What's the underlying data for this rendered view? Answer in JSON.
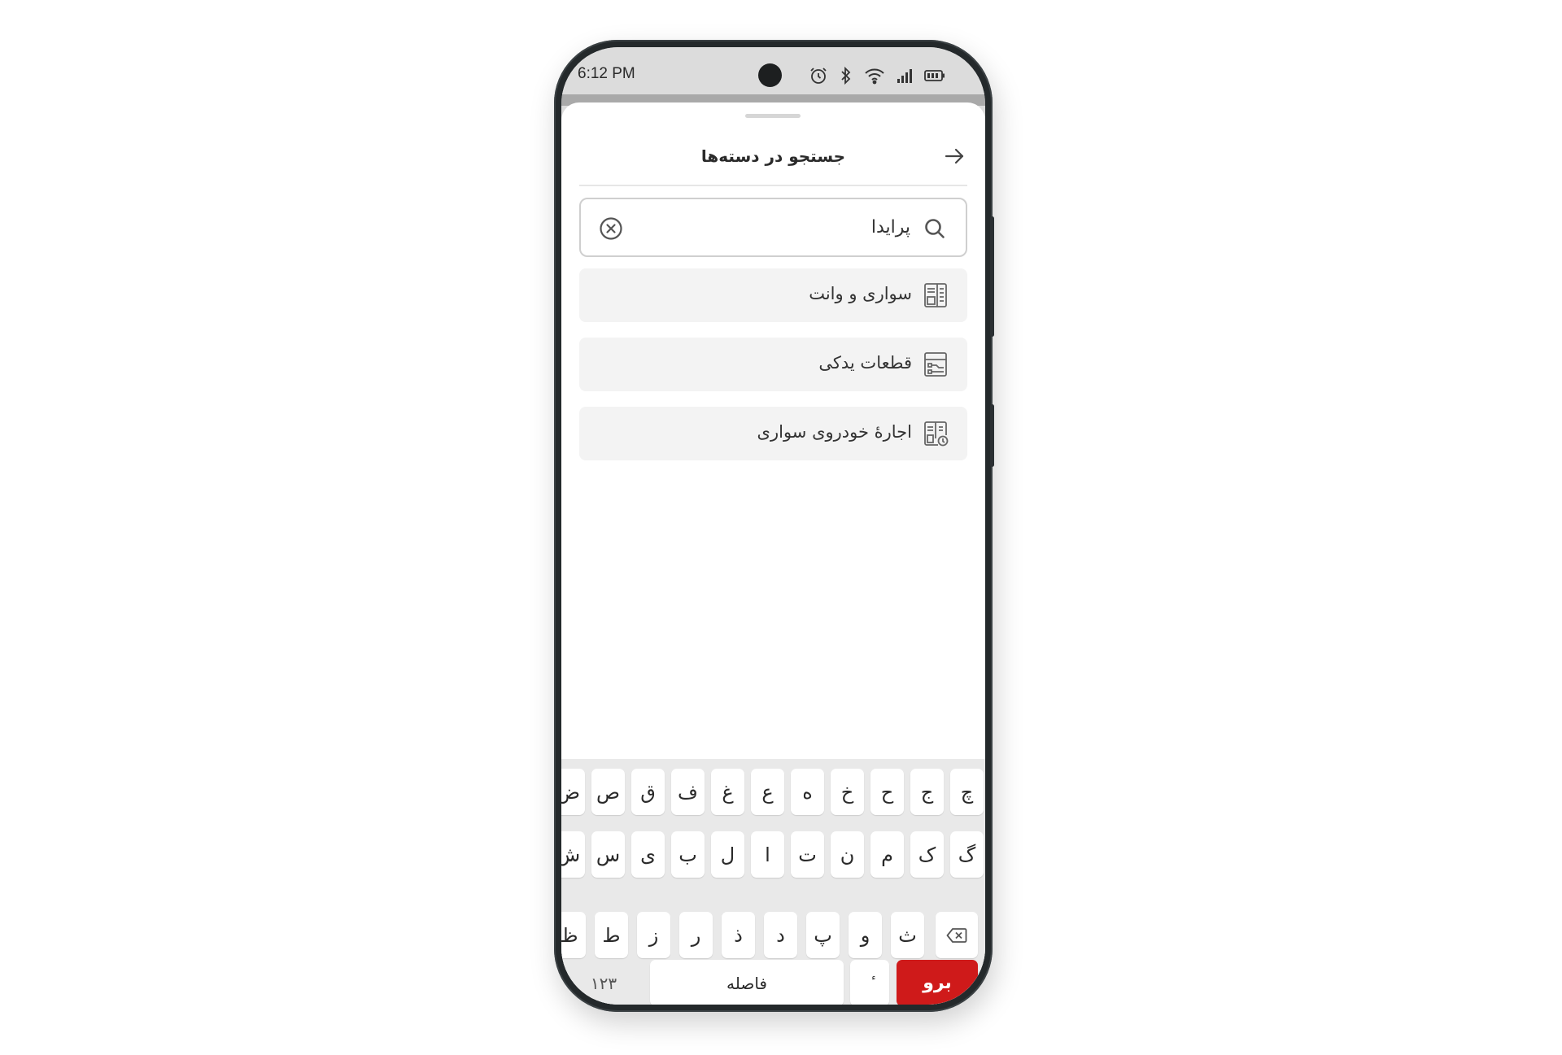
{
  "status_bar": {
    "time": "6:12 PM"
  },
  "header": {
    "title": "جستجو در دسته‌ها"
  },
  "search": {
    "value": "پرایدا"
  },
  "results": [
    {
      "label": "سواری و وانت",
      "icon": "car-category-icon"
    },
    {
      "label": "قطعات یدکی",
      "icon": "spare-parts-category-icon"
    },
    {
      "label": "اجارهٔ خودروی سواری",
      "icon": "car-rental-category-icon"
    }
  ],
  "keyboard": {
    "row1": [
      "چ",
      "ج",
      "ح",
      "خ",
      "ه",
      "ع",
      "غ",
      "ف",
      "ق",
      "ص",
      "ض"
    ],
    "row2": [
      "گ",
      "ک",
      "م",
      "ن",
      "ت",
      "ا",
      "ل",
      "ب",
      "ی",
      "س",
      "ش"
    ],
    "row3": [
      "ث",
      "و",
      "پ",
      "د",
      "ذ",
      "ر",
      "ز",
      "ط",
      "ظ"
    ],
    "go_label": "برو",
    "shift_label": "ٔ",
    "space_label": "فاصله",
    "numbers_label": "۱۲۳"
  },
  "colors": {
    "accent": "#cf1a1a"
  }
}
